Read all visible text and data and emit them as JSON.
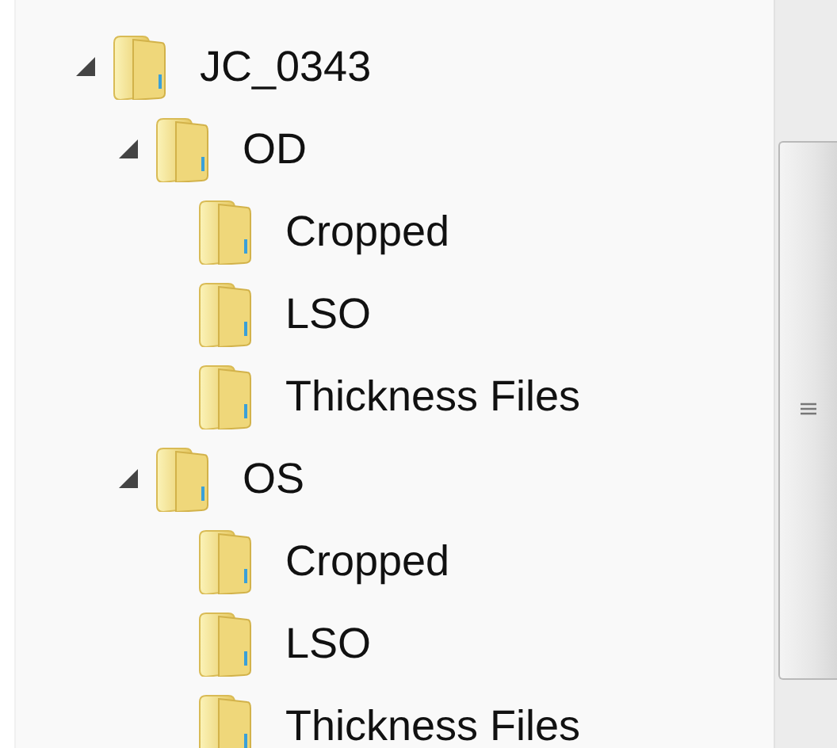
{
  "tree": [
    {
      "label": "JC_0343",
      "expanded": true,
      "children": [
        {
          "label": "OD",
          "expanded": true,
          "children": [
            {
              "label": "Cropped"
            },
            {
              "label": "LSO"
            },
            {
              "label": "Thickness Files"
            }
          ]
        },
        {
          "label": "OS",
          "expanded": true,
          "children": [
            {
              "label": "Cropped"
            },
            {
              "label": "LSO"
            },
            {
              "label": "Thickness Files"
            }
          ]
        }
      ]
    }
  ]
}
